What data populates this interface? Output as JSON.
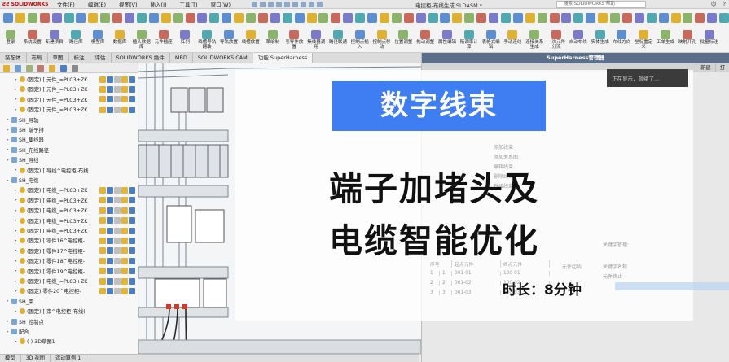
{
  "app": {
    "brand": "SOLIDWORKS",
    "document_title": "电控柜-布线生成.SLDASM *",
    "search_placeholder": "搜索 SOLIDWORKS 帮助",
    "help_menu": "?",
    "user_glyph": "☺"
  },
  "menu": [
    "文件(F)",
    "编辑(E)",
    "视图(V)",
    "插入(I)",
    "工具(T)",
    "窗口(W)"
  ],
  "command_manager": [
    "登录",
    "系统设置",
    "新建项目",
    "路径库",
    "模型库",
    "数据库",
    "插头数据库",
    "元件插座",
    "阵列",
    "线槽导轨翻装",
    "导轨放置",
    "线槽放置",
    "草绘制",
    "引导件放置",
    "集线器调用",
    "路径联通",
    "控制点插入",
    "控制点移动",
    "位置调整",
    "拖动调整",
    "属性编辑",
    "精调率计算",
    "表格式编辑",
    "手动连线",
    "连接关系生成",
    "一次元件分流",
    "自动布线",
    "实体生成",
    "布线方向",
    "坐标重定义",
    "工单生成",
    "映射开孔",
    "批量标注"
  ],
  "tabs": [
    "装配体",
    "布局",
    "草图",
    "标注",
    "评估",
    "SOLIDWORKS 插件",
    "MBD",
    "SOLIDWORKS CAM",
    "功能 SuperHarness"
  ],
  "active_tab": 8,
  "tree": [
    {
      "label": "(固定) [ 元件_=PLC3+ZK",
      "type": "part",
      "icons": true
    },
    {
      "label": "(固定) [ 元件_=PLC3+ZK",
      "type": "part",
      "icons": true
    },
    {
      "label": "(固定) [ 元件_=PLC3+ZK",
      "type": "part",
      "icons": true
    },
    {
      "label": "(固定) [ 元件_=PLC3+ZK",
      "type": "part",
      "icons": true
    },
    {
      "label": "SH_导轨",
      "type": "folder",
      "icons": false
    },
    {
      "label": "SH_端子排",
      "type": "folder",
      "icons": false
    },
    {
      "label": "SH_集线器",
      "type": "folder",
      "icons": false
    },
    {
      "label": "SH_布线路径",
      "type": "folder",
      "icons": false
    },
    {
      "label": "SH_导线",
      "type": "folder",
      "icons": false
    },
    {
      "label": "(固定) [ 导线^电控柜-布线",
      "type": "part",
      "icons": false
    },
    {
      "label": "SH_电缆",
      "type": "folder",
      "icons": false
    },
    {
      "label": "(固定) [ 电缆_=PLC3+ZK",
      "type": "part",
      "icons": true
    },
    {
      "label": "(固定) [ 电缆_=PLC3+ZK",
      "type": "part",
      "icons": true
    },
    {
      "label": "(固定) [ 电缆_=PLC3+ZK",
      "type": "part",
      "icons": true
    },
    {
      "label": "(固定) [ 电缆_=PLC3+ZK",
      "type": "part",
      "icons": true
    },
    {
      "label": "(固定) [ 电缆_=PLC3+ZK",
      "type": "part",
      "icons": true
    },
    {
      "label": "(固定) [ 零件16^电控柜-",
      "type": "part",
      "icons": true
    },
    {
      "label": "(固定) [ 零件17^电控柜-",
      "type": "part",
      "icons": true
    },
    {
      "label": "(固定) [ 零件18^电控柜-",
      "type": "part",
      "icons": true
    },
    {
      "label": "(固定) [ 零件19^电控柜-",
      "type": "part",
      "icons": true
    },
    {
      "label": "(固定) [ 电缆_=PLC3+ZK",
      "type": "part",
      "icons": true
    },
    {
      "label": "(固定) 零件20^电控柜-",
      "type": "part",
      "icons": true
    },
    {
      "label": "SH_束",
      "type": "folder",
      "icons": false
    },
    {
      "label": "(固定) [ 束^电控柜-布线(",
      "type": "part",
      "icons": false
    },
    {
      "label": "SH_控制点",
      "type": "folder",
      "icons": false
    },
    {
      "label": "配合",
      "type": "folder",
      "icons": false
    },
    {
      "label": "(-) 3D草图1",
      "type": "part",
      "icons": false
    }
  ],
  "bottom_tabs": [
    "模型",
    "3D 视图",
    "运动算例 1"
  ],
  "panel": {
    "title": "SuperHarness管理器",
    "tabs": [
      "新建",
      "打"
    ],
    "tip": "正在显示，就绪了..."
  },
  "ghost_menu": [
    "添加线束",
    "添加关系图",
    "编辑线束",
    "删除线束",
    "升级线束"
  ],
  "ghost_table": {
    "header": [
      "序号",
      "起点元件",
      "终点元件"
    ],
    "rows": [
      [
        "1",
        "1",
        "001-01",
        "100-01"
      ],
      [
        "2",
        "2",
        "001-02",
        "100-02"
      ],
      [
        "3",
        "3",
        "001-03",
        "100-03"
      ]
    ]
  },
  "ghost_right": [
    "关键字管理:",
    "关键字名称",
    "元件起始",
    "元件终止"
  ],
  "overlay": {
    "banner": "数字线束",
    "headline_1": "端子加堵头及",
    "headline_2": "电缆智能优化",
    "duration": "时长：8分钟"
  },
  "colors": {
    "banner": "#3f7df2",
    "panel_header": "#5b6f8a",
    "brand": "#c00000"
  }
}
